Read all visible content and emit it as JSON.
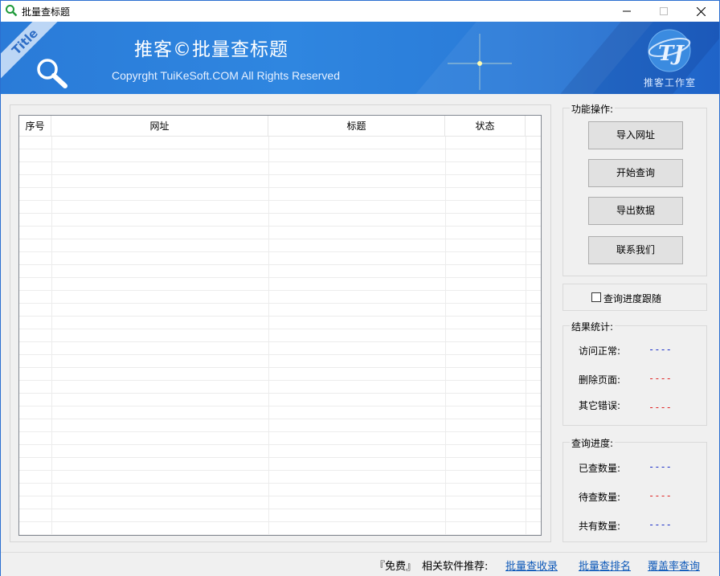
{
  "window": {
    "title": "批量查标题",
    "controls": {
      "minimize": "—",
      "maximize": "☐",
      "close": "✕"
    }
  },
  "banner": {
    "ribbon": "Title",
    "main_title": "推客©批量查标题",
    "copyright": "Copyrght TuiKeSoft.COM All Rights Reserved",
    "logo_text": "推客工作室"
  },
  "grid": {
    "columns": [
      "序号",
      "网址",
      "标题",
      "状态"
    ]
  },
  "actions": {
    "legend": "功能操作:",
    "import_label": "导入网址",
    "start_label": "开始查询",
    "export_label": "导出数据",
    "contact_label": "联系我们"
  },
  "follow": {
    "label": "查询进度跟随",
    "checked": false
  },
  "results": {
    "legend": "结果统计:",
    "items": [
      {
        "label": "访问正常:",
        "value": "----",
        "color": "#1a2ec8"
      },
      {
        "label": "删除页面:",
        "value": "----",
        "color": "#e02424"
      },
      {
        "label": "其它错误:",
        "value": "----",
        "color": "#e02424"
      }
    ]
  },
  "progress": {
    "legend": "查询进度:",
    "items": [
      {
        "label": "已查数量:",
        "value": "----",
        "color": "#1a2ec8"
      },
      {
        "label": "待查数量:",
        "value": "----",
        "color": "#e02424"
      },
      {
        "label": "共有数量:",
        "value": "----",
        "color": "#1a2ec8"
      }
    ]
  },
  "statusbar": {
    "free": "『免费』",
    "recommend": "相关软件推荐:",
    "links": [
      "批量查收录",
      "批量查排名",
      "覆盖率查询"
    ]
  }
}
